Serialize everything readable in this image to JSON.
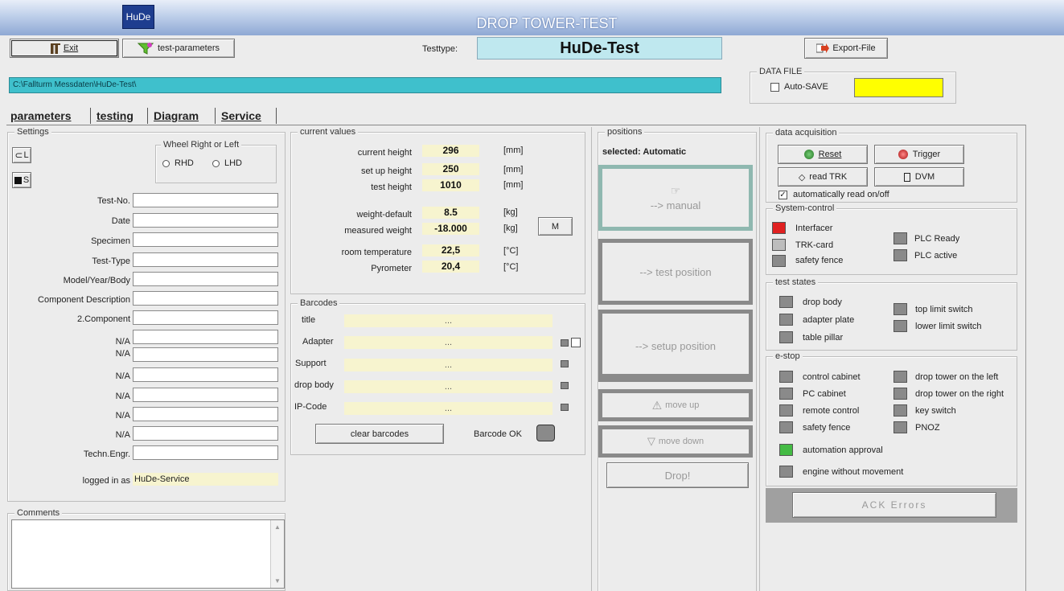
{
  "app": {
    "logo": "HuDe",
    "title": "DROP TOWER-TEST"
  },
  "toolbar": {
    "exit_label": "Exit",
    "test_params_label": "test-parameters",
    "testtype_label": "Testtype:",
    "testtype_value": "HuDe-Test",
    "export_label": "Export-File"
  },
  "path": {
    "value": "C:\\Fallturm Messdaten\\HuDe-Test\\"
  },
  "datafile": {
    "legend": "DATA FILE",
    "autosave_label": "Auto-SAVE",
    "color": "#ffff00"
  },
  "tabs": [
    {
      "label": "parameters"
    },
    {
      "label": "testing"
    },
    {
      "label": "Diagram"
    },
    {
      "label": "Service"
    }
  ],
  "settings": {
    "legend": "Settings",
    "load_label": "L",
    "save_label": "S",
    "wheel_legend": "Wheel Right or Left",
    "rhd": "RHD",
    "lhd": "LHD",
    "fields": [
      {
        "label": "Test-No.",
        "value": ""
      },
      {
        "label": "Date",
        "value": ""
      },
      {
        "label": "Specimen",
        "value": ""
      },
      {
        "label": "Test-Type",
        "value": ""
      },
      {
        "label": "Model/Year/Body",
        "value": ""
      },
      {
        "label": "Component Description",
        "value": ""
      },
      {
        "label": "2.Component",
        "value": ""
      },
      {
        "label": "N/A",
        "value": ""
      },
      {
        "label": "N/A",
        "value": ""
      },
      {
        "label": "N/A",
        "value": ""
      },
      {
        "label": "N/A",
        "value": ""
      },
      {
        "label": "N/A",
        "value": ""
      },
      {
        "label": "N/A",
        "value": ""
      },
      {
        "label": "Techn.Engr.",
        "value": ""
      }
    ],
    "logged_label": "logged in as",
    "logged_value": "HuDe-Service",
    "comments_legend": "Comments"
  },
  "current": {
    "legend": "current values",
    "rows": [
      {
        "label": "current height",
        "value": "296",
        "unit": "[mm]"
      },
      {
        "label": "set up height",
        "value": "250",
        "unit": "[mm]"
      },
      {
        "label": "test height",
        "value": "1010",
        "unit": "[mm]"
      },
      {
        "label": "weight-default",
        "value": "8.5",
        "unit": "[kg]"
      },
      {
        "label": "measured weight",
        "value": "-18.000",
        "unit": "[kg]"
      },
      {
        "label": "room temperature",
        "value": "22,5",
        "unit": "[°C]"
      },
      {
        "label": "Pyrometer",
        "value": "20,4",
        "unit": "[°C]"
      }
    ],
    "m_button": "M"
  },
  "barcodes": {
    "legend": "Barcodes",
    "rows": [
      {
        "label": "title",
        "value": "..."
      },
      {
        "label": "Adapter",
        "value": "..."
      },
      {
        "label": "Support",
        "value": "..."
      },
      {
        "label": "drop body",
        "value": "..."
      },
      {
        "label": "IP-Code",
        "value": "..."
      }
    ],
    "clear_label": "clear barcodes",
    "ok_label": "Barcode OK"
  },
  "positions": {
    "legend": "positions",
    "selected": "selected: Automatic",
    "manual": "--> manual",
    "test_position": "--> test position",
    "setup_position": "--> setup position",
    "move_up": "move up",
    "move_down": "move down",
    "drop": "Drop!"
  },
  "daq": {
    "legend": "data acquisition",
    "reset": "Reset",
    "trigger": "Trigger",
    "read_trk": "read TRK",
    "dvm": "DVM",
    "auto_read": "automatically read  on/off"
  },
  "system": {
    "legend": "System-control",
    "interfacer": "Interfacer",
    "trk_card": "TRK-card",
    "safety_fence": "safety fence",
    "plc_ready": "PLC Ready",
    "plc_active": "PLC active"
  },
  "states": {
    "legend": "test states",
    "drop_body": "drop body",
    "adapter_plate": "adapter plate",
    "table_pillar": "table pillar",
    "top_limit": "top limit switch",
    "lower_limit": "lower limit switch"
  },
  "estop": {
    "legend": "e-stop",
    "control_cabinet": "control cabinet",
    "pc_cabinet": "PC cabinet",
    "remote_control": "remote control",
    "safety_fence": "safety fence",
    "left": "drop tower on the left",
    "right": "drop tower on the right",
    "key_switch": "key switch",
    "pnoz": "PNOZ",
    "automation_approval": "automation approval",
    "engine_without_movement": "engine without movement"
  },
  "ack": {
    "label": "ACK Errors"
  }
}
